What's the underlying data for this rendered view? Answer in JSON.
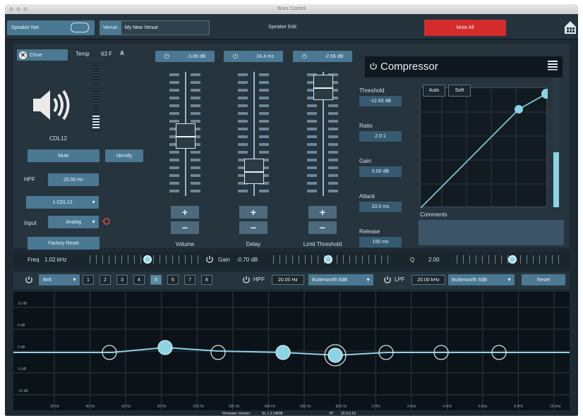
{
  "window": {
    "title": "Worx Control"
  },
  "topbar": {
    "speaker_net": "Speaker Net",
    "venue_label": "Venue:",
    "venue_value": "My New Venue",
    "speaker_edit": "Speaker Edit",
    "mute_all": "Mute All"
  },
  "speaker": {
    "close_label": "Close",
    "temp_label": "Temp",
    "temp_value": "63 F",
    "temp_glyph": "A",
    "name": "CDL12",
    "mute": "Mute",
    "identify": "Identify",
    "hpf_label": "HPF",
    "hpf_value": "20.00 Hz",
    "preset": "1-CDL12",
    "input_label": "Input",
    "input_value": "Analog",
    "factory_reset": "Factory Reset"
  },
  "faders": [
    {
      "name": "Volume",
      "value": "-3.89 dB",
      "level": 0.48
    },
    {
      "name": "Delay",
      "value": "24.4 ms",
      "level": 0.12
    },
    {
      "name": "Limit Threshold",
      "value": "-2.56 dB",
      "level": 0.97
    }
  ],
  "compressor": {
    "title": "Compressor",
    "threshold_label": "Threshold",
    "threshold_value": "-12.83 dB",
    "ratio_label": "Ratio",
    "ratio_value": "2.0:1",
    "gain_label": "Gain",
    "gain_value": "0.00 dB",
    "attack_label": "Attack",
    "attack_value": "20.0 ms",
    "release_label": "Release",
    "release_value": "150 ms",
    "auto": "Auto",
    "soft": "Soft",
    "comments_label": "Comments"
  },
  "eq_params": {
    "freq_label": "Freq",
    "freq_value": "1.02 kHz",
    "gain_label": "Gain",
    "gain_value": "-0.70 dB",
    "q_label": "Q",
    "q_value": "2.00"
  },
  "eq_bar": {
    "filter_type": "Bell",
    "bands": [
      "1",
      "2",
      "3",
      "4",
      "5",
      "6",
      "7",
      "8"
    ],
    "selected_band": "5",
    "hpf_label": "HPF",
    "hpf_value": "20.00 Hz",
    "hpf_type": "Butterworth 6dB",
    "lpf_label": "LPF",
    "lpf_value": "20.00 kHz",
    "lpf_type": "Butterworth 6dB",
    "reset": "Reset"
  },
  "eq_graph": {
    "y_labels": [
      "12 dB",
      "6 dB",
      "0 dB",
      "-6 dB",
      "-12 dB"
    ],
    "x_labels": [
      "20 Hz",
      "40 Hz",
      "60 Hz",
      "80 Hz",
      "200 Hz",
      "300 Hz",
      "400 Hz",
      "600 Hz",
      "800 Hz",
      "2 kHz",
      "3 kHz",
      "4 kHz",
      "6 kHz",
      "8 kHz",
      "15 kHz"
    ]
  },
  "status": {
    "firmware_label": "Firmware Version:",
    "firmware_value": "SL 1.2.14608",
    "ip_label": "IP:",
    "ip_value": "10.0.0.16"
  },
  "colors": {
    "accent": "#8ad4e3",
    "mute_all": "#d42b2b",
    "button": "#4b7892"
  },
  "icons": [
    "speaker-icon",
    "home-icon",
    "power-icon",
    "close-icon",
    "menu-icon",
    "input-warning-icon"
  ]
}
